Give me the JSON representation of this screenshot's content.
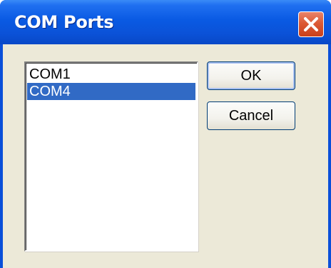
{
  "window": {
    "title": "COM Ports"
  },
  "titlebar": {
    "close_icon": "close-icon"
  },
  "ports_list": {
    "items": [
      {
        "label": "COM1",
        "selected": false
      },
      {
        "label": "COM4",
        "selected": true
      }
    ]
  },
  "buttons": {
    "ok_label": "OK",
    "cancel_label": "Cancel"
  },
  "colors": {
    "titlebar_blue": "#0a5ae3",
    "selection_blue": "#316ac5",
    "dialog_face": "#ece9d8",
    "close_red": "#dc5a35"
  }
}
